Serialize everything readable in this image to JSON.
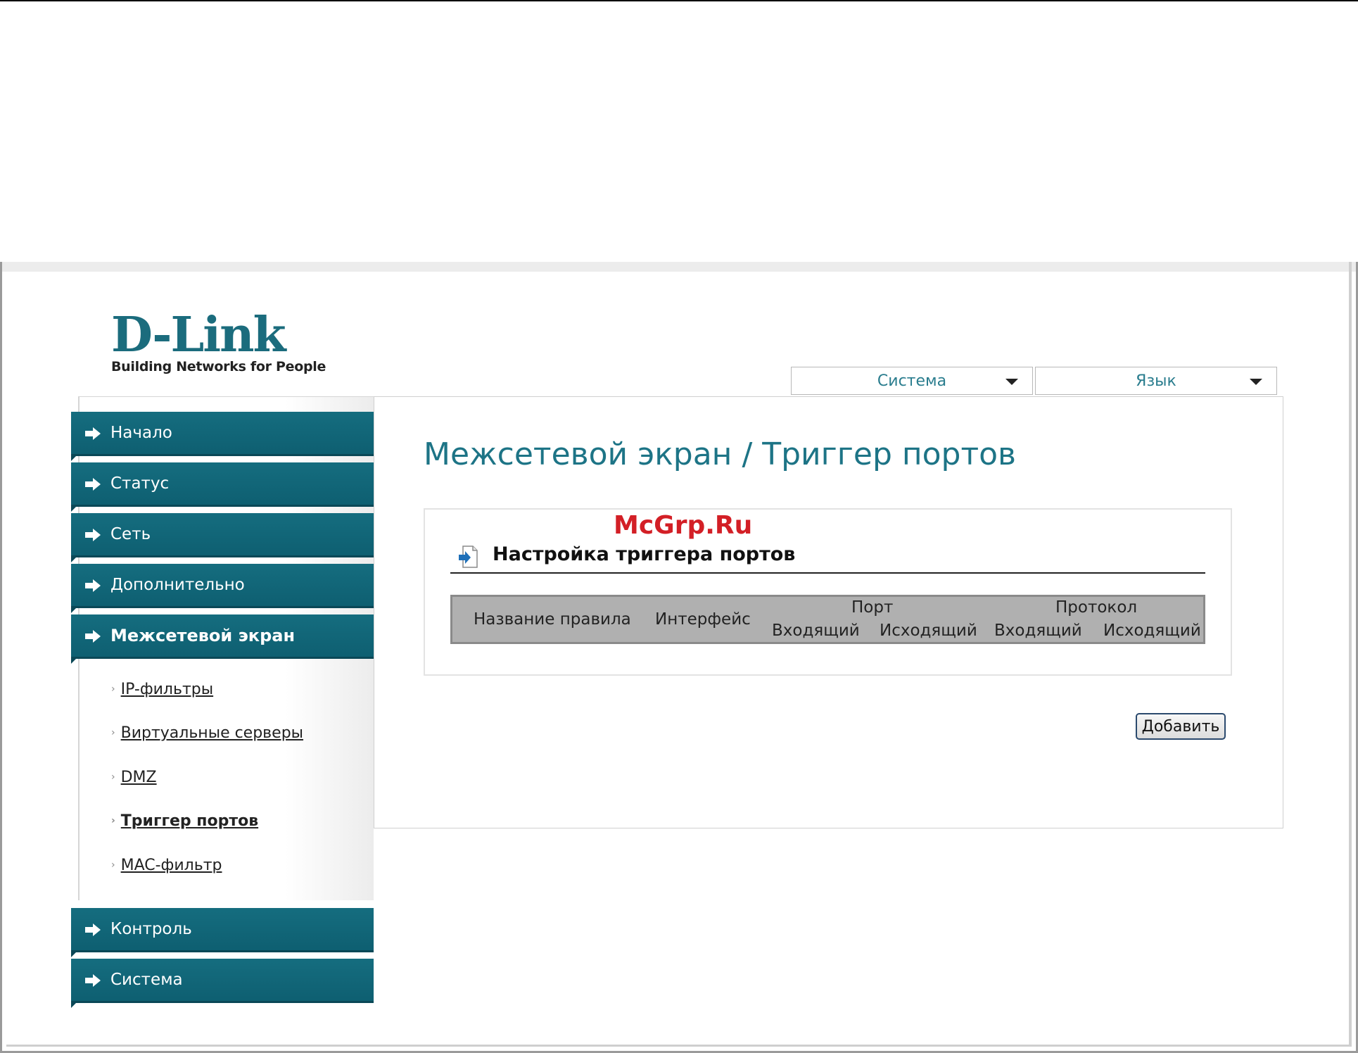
{
  "logo": {
    "brand": "D-Link",
    "tagline": "Building Networks for People"
  },
  "header": {
    "system_menu": {
      "label": "Система"
    },
    "language_menu": {
      "label": "Язык"
    }
  },
  "sidebar": {
    "items": [
      {
        "label": "Начало"
      },
      {
        "label": "Статус"
      },
      {
        "label": "Сеть"
      },
      {
        "label": "Дополнительно"
      },
      {
        "label": "Межсетевой экран",
        "active": true
      },
      {
        "label": "Контроль"
      },
      {
        "label": "Система"
      }
    ],
    "firewall_subitems": [
      {
        "label": "IP-фильтры"
      },
      {
        "label": "Виртуальные серверы"
      },
      {
        "label": "DMZ"
      },
      {
        "label": "Триггер портов",
        "active": true
      },
      {
        "label": "MAC-фильтр"
      }
    ]
  },
  "main": {
    "page_title": "Межсетевой экран / Триггер портов",
    "watermark": "McGrp.Ru",
    "section_title": "Настройка триггера портов",
    "table": {
      "columns": {
        "rule_name": "Название правила",
        "interface": "Интерфейс",
        "port": "Порт",
        "protocol": "Протокол",
        "port_incoming": "Входящий",
        "port_outgoing": "Исходящий",
        "protocol_incoming": "Входящий",
        "protocol_outgoing": "Исходящий"
      },
      "rows": []
    },
    "add_button": "Добавить"
  },
  "colors": {
    "accent": "#1d7486",
    "nav_background": "#156d7f",
    "watermark": "#d31f26",
    "table_header": "#b0b0b0"
  }
}
